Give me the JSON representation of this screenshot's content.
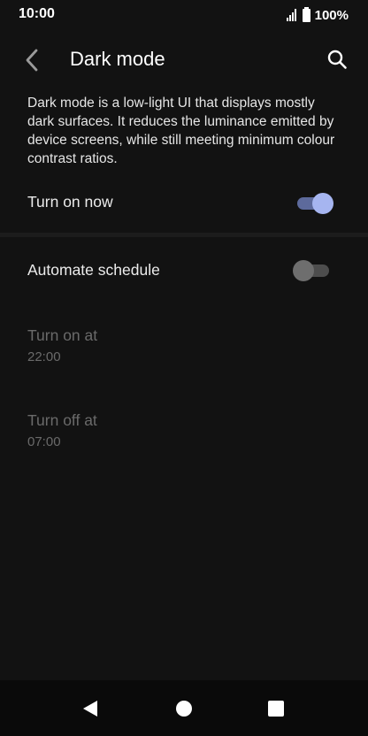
{
  "status_bar": {
    "time": "10:00",
    "battery": "100%"
  },
  "app_bar": {
    "title": "Dark mode",
    "back_icon": "chevron-left-icon",
    "search_icon": "search-icon"
  },
  "description": "Dark mode is a low-light UI that displays mostly dark surfaces. It reduces the luminance emitted by device screens, while still meeting minimum colour contrast ratios.",
  "settings": {
    "turn_on_now": {
      "label": "Turn on now",
      "enabled": true
    },
    "automate_schedule": {
      "label": "Automate schedule",
      "enabled": false
    },
    "turn_on_at": {
      "label": "Turn on at",
      "value": "22:00"
    },
    "turn_off_at": {
      "label": "Turn off at",
      "value": "07:00"
    }
  },
  "nav_bar": {
    "back_icon": "triangle-back-icon",
    "home_icon": "circle-home-icon",
    "recents_icon": "square-recents-icon"
  },
  "colors": {
    "background": "#121212",
    "accent_track": "#5d6a9c",
    "accent_thumb": "#a6b5f0",
    "disabled_text": "#6a6a6a"
  }
}
